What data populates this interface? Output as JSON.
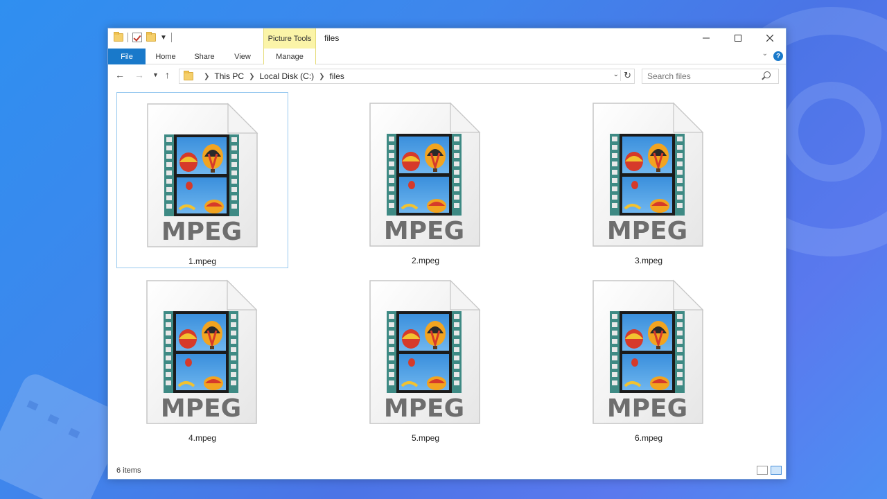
{
  "quick_access": {
    "icons": [
      "folder-icon",
      "properties-icon",
      "new-folder-icon",
      "customize-dropdown-icon"
    ]
  },
  "context_tab": {
    "label": "Picture Tools"
  },
  "window": {
    "title": "files"
  },
  "ribbon": {
    "tabs": [
      {
        "label": "File"
      },
      {
        "label": "Home"
      },
      {
        "label": "Share"
      },
      {
        "label": "View"
      },
      {
        "label": "Manage"
      }
    ]
  },
  "address": {
    "crumbs": [
      "This PC",
      "Local Disk (C:)",
      "files"
    ]
  },
  "search": {
    "placeholder": "Search files"
  },
  "files": [
    {
      "name": "1.mpeg",
      "type_label": "MPEG",
      "selected": true
    },
    {
      "name": "2.mpeg",
      "type_label": "MPEG",
      "selected": false
    },
    {
      "name": "3.mpeg",
      "type_label": "MPEG",
      "selected": false
    },
    {
      "name": "4.mpeg",
      "type_label": "MPEG",
      "selected": false
    },
    {
      "name": "5.mpeg",
      "type_label": "MPEG",
      "selected": false
    },
    {
      "name": "6.mpeg",
      "type_label": "MPEG",
      "selected": false
    }
  ],
  "status": {
    "item_count": "6 items",
    "view_modes": [
      "details-view-icon",
      "large-icons-view-icon"
    ],
    "active_view": "large-icons-view-icon"
  },
  "colors": {
    "file_tab": "#1979ca",
    "context_tab": "#fbf4a8",
    "selection": "#99c9ef",
    "desktop": "#3f86ec"
  }
}
